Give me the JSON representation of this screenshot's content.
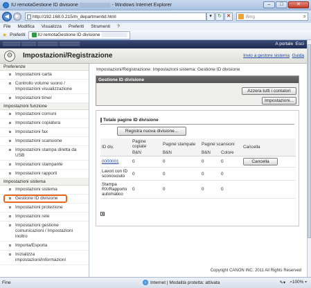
{
  "browser": {
    "window_title": "IU remotaGestione ID divisione",
    "window_title_suffix": "- Windows Internet Explorer",
    "address": "http://192.168.0.215/m_departmentid.html",
    "search_placeholder": "Bing",
    "menu": [
      "File",
      "Modifica",
      "Visualizza",
      "Preferiti",
      "Strumenti",
      "?"
    ],
    "favorites_label": "Preferiti",
    "tab_label": "IU remotaGestione ID divisione",
    "status_left": "Fine",
    "status_zone": "Internet | Modalità protetta: attivata",
    "zoom": "100%"
  },
  "header": {
    "portal_link": "A portale",
    "exit_link": "Esci",
    "page_title": "Impostazioni/Registrazione",
    "send_admin_link": "Invio a gestore sistema",
    "guide_link": "Guida"
  },
  "sidebar": {
    "sections": [
      {
        "title": "Preferenze",
        "items": [
          "Impostazioni carta",
          "Controllo volume suono / Impostazioni visualizzazione",
          "Impostazioni timer"
        ]
      },
      {
        "title": "Impostazioni funzione",
        "items": [
          "Impostazioni comuni",
          "Impostazioni copiatura",
          "Impostazioni fax",
          "Impostazioni scansione",
          "Impostazioni stampa diretta da USB",
          "Impostazioni stampante",
          "Impostazioni rapporti"
        ]
      },
      {
        "title": "Impostazioni sistema",
        "items": [
          "Impostazioni sistema",
          "Gestione ID divisione",
          "Impostazioni protezione",
          "Impostazioni rete",
          "Impostazioni gestione comunicazioni / Impostazioni inoltro",
          "Importa/Esporta",
          "Inizializza impostazioni/informazioni"
        ]
      }
    ]
  },
  "content": {
    "breadcrumb": "Impostazioni/Registrazione: Impostazioni sistema: Gestione ID divisione",
    "panel_title": "Gestione ID divisione",
    "reset_button": "Azzera tutti i contatori",
    "settings_button": "Impostazioni...",
    "totals_title": "Totale pagine ID divisione",
    "register_button": "Registra nuova divisione...",
    "columns": {
      "id": "ID div.",
      "copies": "Pagine copiate",
      "prints": "Pagine stampate",
      "scans": "Pagine scansioni",
      "delete": "Cancella",
      "bw": "B&N",
      "color": "Colore"
    },
    "rows": [
      {
        "id": "0000001",
        "copies_bw": "0",
        "prints_bw": "0",
        "scans_bw": "0",
        "scans_color": "0",
        "action": "Cancella"
      },
      {
        "id": "Lavori con ID sconosciuto",
        "copies_bw": "0",
        "prints_bw": "0",
        "scans_bw": "0",
        "scans_color": "0",
        "action": ""
      },
      {
        "id": "Stampa RX/Rapporto automatico",
        "copies_bw": "0",
        "prints_bw": "0",
        "scans_bw": "0",
        "scans_color": "0",
        "action": ""
      }
    ],
    "copyright": "Copyright CANON INC. 2011 All Rights Reserved"
  }
}
